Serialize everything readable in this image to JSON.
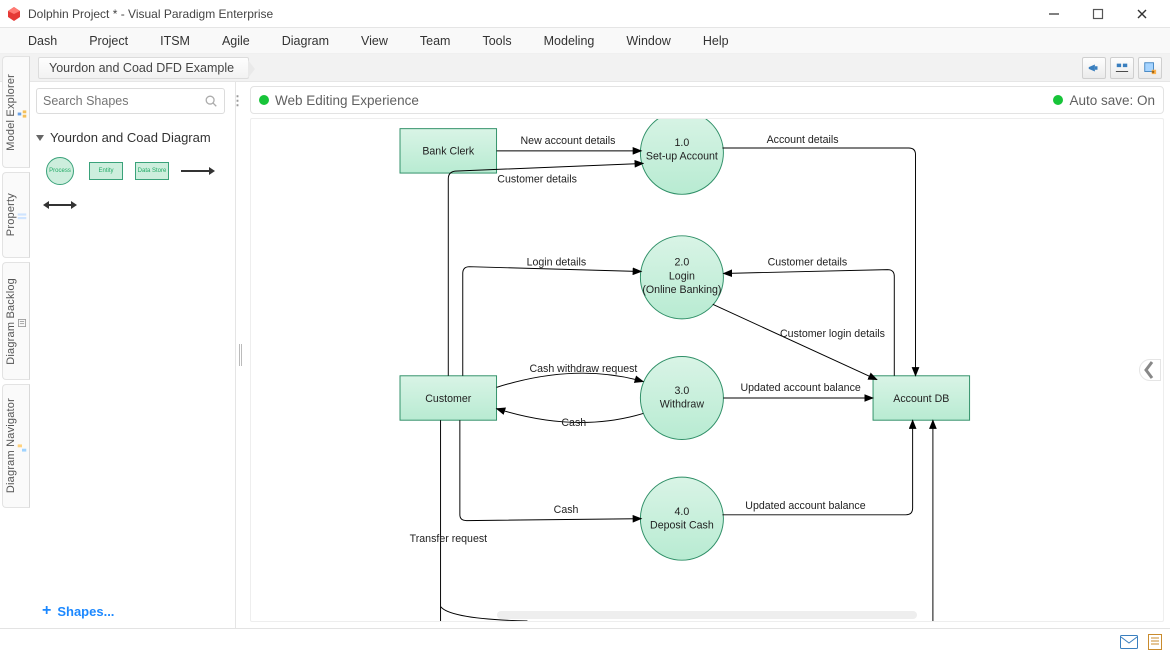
{
  "app": {
    "title": "Dolphin Project * - Visual Paradigm Enterprise"
  },
  "window_controls": {
    "minimize": "–",
    "maximize": "▢",
    "close": "✕"
  },
  "menu": [
    "Dash",
    "Project",
    "ITSM",
    "Agile",
    "Diagram",
    "View",
    "Team",
    "Tools",
    "Modeling",
    "Window",
    "Help"
  ],
  "breadcrumb": "Yourdon and Coad DFD Example",
  "toolbar_icons": [
    "announce-icon",
    "align-icon",
    "new-diagram-icon"
  ],
  "side_tabs": [
    {
      "name": "model-explorer-tab",
      "label": "Model Explorer"
    },
    {
      "name": "property-tab",
      "label": "Property"
    },
    {
      "name": "diagram-backlog-tab",
      "label": "Diagram Backlog"
    },
    {
      "name": "diagram-navigator-tab",
      "label": "Diagram Navigator"
    }
  ],
  "sidebar": {
    "search_placeholder": "Search Shapes",
    "section_title": "Yourdon and Coad Diagram",
    "palette_labels": {
      "process": "Process",
      "entity": "Entity",
      "datastore": "Data Store"
    },
    "shapes_link": "Shapes..."
  },
  "infobar": {
    "left_status": "Web Editing Experience",
    "right_status": "Auto save: On"
  },
  "diagram": {
    "entities": {
      "bank_clerk": "Bank Clerk",
      "customer": "Customer",
      "account_db": "Account DB"
    },
    "processes": {
      "p1": {
        "id": "1.0",
        "name": "Set-up Account"
      },
      "p2": {
        "id": "2.0",
        "name_line1": "Login",
        "name_line2": "(Online Banking)"
      },
      "p3": {
        "id": "3.0",
        "name": "Withdraw"
      },
      "p4": {
        "id": "4.0",
        "name": "Deposit Cash"
      }
    },
    "flows": {
      "new_account_details": "New account details",
      "customer_details_1": "Customer details",
      "account_details": "Account details",
      "login_details": "Login details",
      "customer_details_2": "Customer details",
      "customer_login_details": "Customer login details",
      "cash_withdraw_request": "Cash withdraw request",
      "cash_back": "Cash",
      "updated_balance_1": "Updated account balance",
      "cash_deposit": "Cash",
      "updated_balance_2": "Updated account balance",
      "transfer_request": "Transfer request"
    }
  },
  "status_icons": [
    "mail-icon",
    "notes-icon"
  ]
}
